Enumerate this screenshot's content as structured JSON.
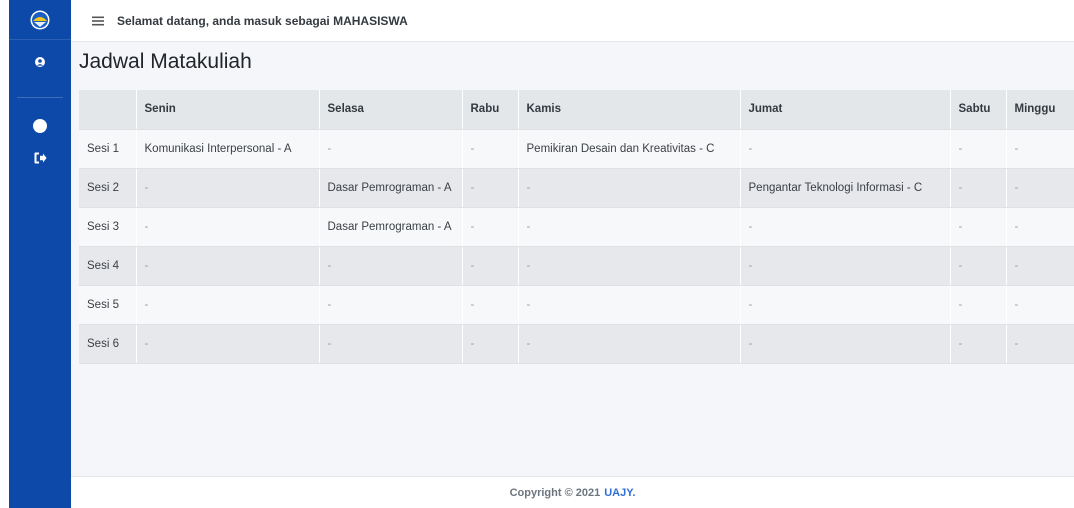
{
  "topbar": {
    "welcome_text": "Selamat datang, anda masuk sebagai MAHASISWA"
  },
  "page": {
    "title": "Jadwal Matakuliah"
  },
  "sidebar": {
    "items": [
      {
        "icon": "user-icon"
      },
      {
        "icon": "circle-icon"
      },
      {
        "icon": "logout-icon"
      }
    ]
  },
  "schedule": {
    "headers": [
      "",
      "Senin",
      "Selasa",
      "Rabu",
      "Kamis",
      "Jumat",
      "Sabtu",
      "Minggu"
    ],
    "rows": [
      {
        "session": "Sesi 1",
        "cells": [
          "Komunikasi Interpersonal - A",
          "-",
          "-",
          "Pemikiran Desain dan Kreativitas - C",
          "-",
          "-",
          "-"
        ]
      },
      {
        "session": "Sesi 2",
        "cells": [
          "-",
          "Dasar Pemrograman - A",
          "-",
          "-",
          "Pengantar Teknologi Informasi - C",
          "-",
          "-"
        ]
      },
      {
        "session": "Sesi 3",
        "cells": [
          "-",
          "Dasar Pemrograman - A",
          "-",
          "-",
          "-",
          "-",
          "-"
        ]
      },
      {
        "session": "Sesi 4",
        "cells": [
          "-",
          "-",
          "-",
          "-",
          "-",
          "-",
          "-"
        ]
      },
      {
        "session": "Sesi 5",
        "cells": [
          "-",
          "-",
          "-",
          "-",
          "-",
          "-",
          "-"
        ]
      },
      {
        "session": "Sesi 6",
        "cells": [
          "-",
          "-",
          "-",
          "-",
          "-",
          "-",
          "-"
        ]
      }
    ]
  },
  "footer": {
    "copyright": "Copyright © 2021",
    "brand": "UAJY."
  },
  "colors": {
    "sidebar": "#0d49a8",
    "accent": "#2f6fd6"
  }
}
